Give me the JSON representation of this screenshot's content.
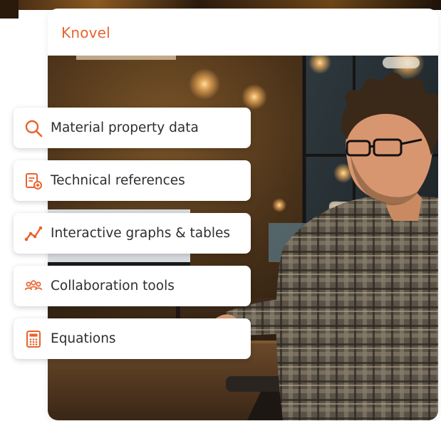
{
  "brand": {
    "name": "Knovel",
    "color": "#e9632c"
  },
  "features": [
    {
      "label": "Material property data",
      "icon": "search-icon"
    },
    {
      "label": "Technical references",
      "icon": "document-add-icon"
    },
    {
      "label": "Interactive graphs & tables",
      "icon": "line-chart-icon"
    },
    {
      "label": "Collaboration tools",
      "icon": "people-group-icon"
    },
    {
      "label": "Equations",
      "icon": "calculator-icon"
    }
  ],
  "photo": {
    "description_icon": "person-at-computer-image"
  }
}
